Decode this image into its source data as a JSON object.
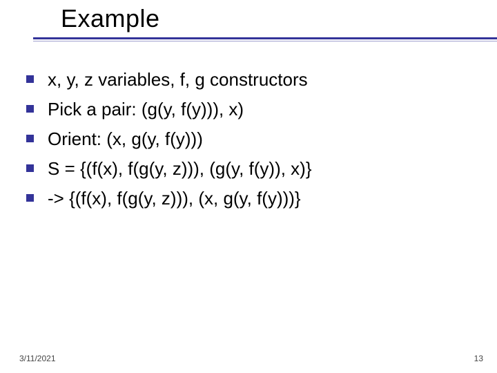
{
  "title": "Example",
  "bullets": [
    "x, y, z variables, f, g constructors",
    "Pick a pair: (g(y, f(y))), x)",
    "Orient: (x, g(y, f(y)))",
    "S = {(f(x), f(g(y, z))), (g(y, f(y)), x)}",
    "-> {(f(x), f(g(y, z))), (x, g(y, f(y)))}"
  ],
  "footer": {
    "date": "3/11/2021",
    "page": "13"
  }
}
